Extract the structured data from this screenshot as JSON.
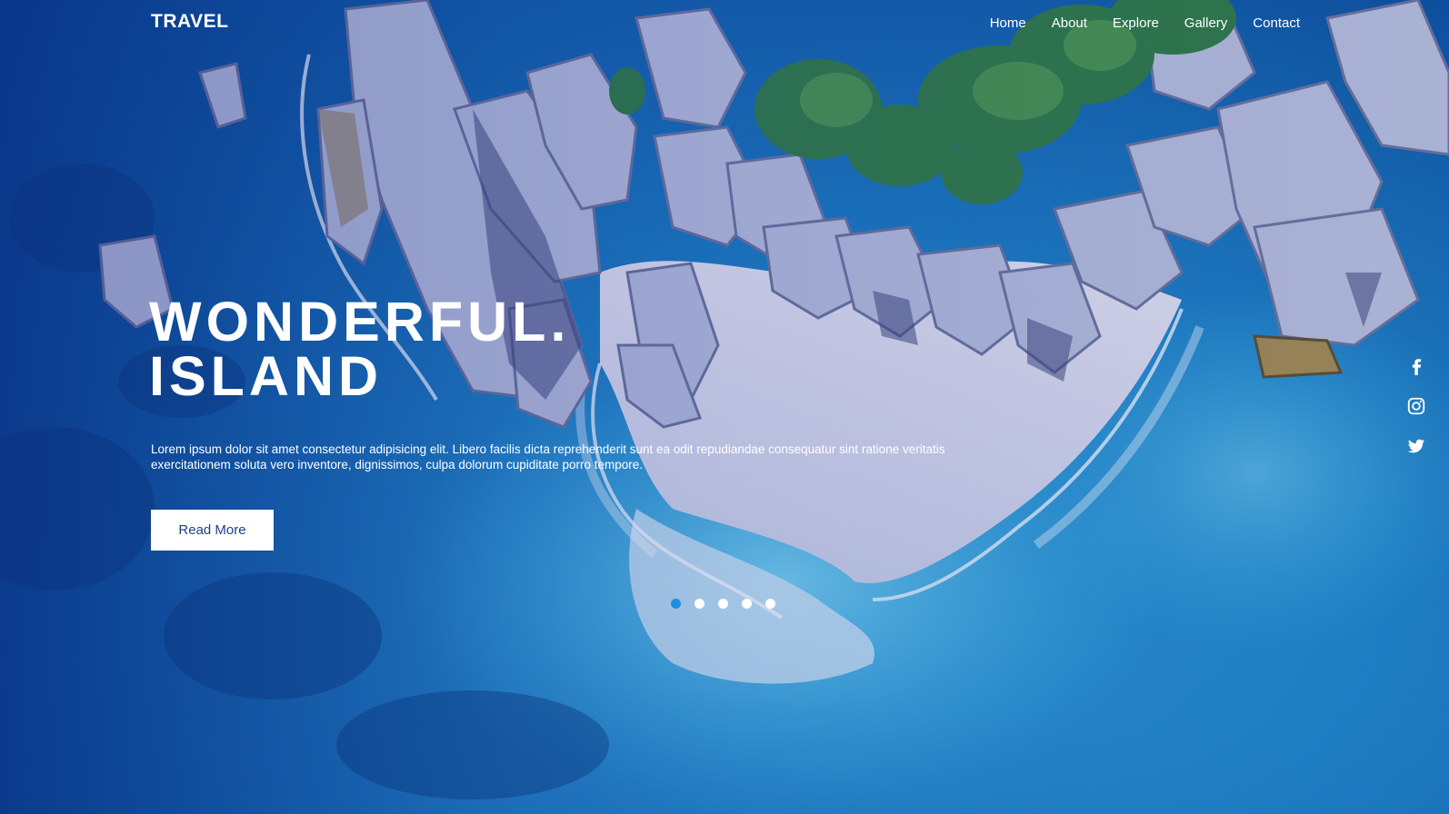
{
  "brand": {
    "logo_text": "TRAVEL"
  },
  "nav": {
    "items": [
      {
        "label": "Home"
      },
      {
        "label": "About"
      },
      {
        "label": "Explore"
      },
      {
        "label": "Gallery"
      },
      {
        "label": "Contact"
      }
    ]
  },
  "hero": {
    "title_line1": "WONDERFUL.",
    "title_line2": "ISLAND",
    "description": "Lorem ipsum dolor sit amet consectetur adipisicing elit. Libero facilis dicta reprehenderit sunt ea odit repudiandae consequatur sint ratione veritatis exercitationem soluta vero inventore, dignissimos, culpa dolorum cupiditate porro tempore.",
    "button_label": "Read More"
  },
  "slider": {
    "slide_count": 5,
    "active_index": 0
  },
  "social": {
    "icons": [
      "facebook-icon",
      "instagram-icon",
      "twitter-icon"
    ]
  },
  "colors": {
    "accent": "#1f8de0",
    "button_text": "#1c3f8a",
    "text": "#ffffff"
  }
}
